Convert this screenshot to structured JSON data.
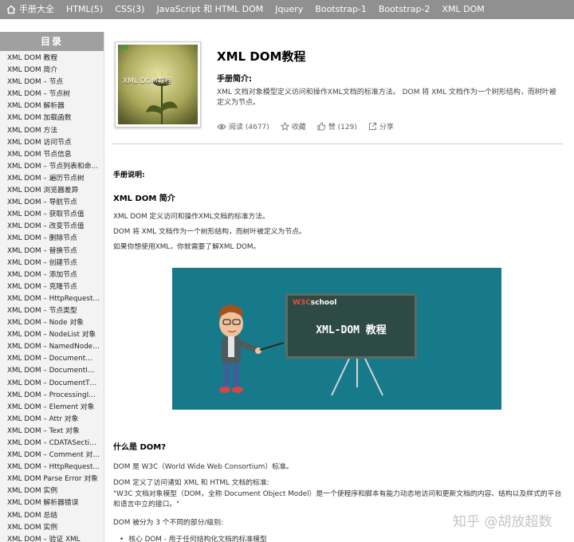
{
  "topnav": {
    "items": [
      "手册大全",
      "HTML(5)",
      "CSS(3)",
      "JavaScript 和 HTML DOM",
      "Jquery",
      "Bootstrap-1",
      "Bootstrap-2",
      "XML DOM"
    ]
  },
  "sidebar": {
    "title": "目录",
    "items": [
      "XML DOM 教程",
      "XML DOM 简介",
      "XML DOM – 节点",
      "XML DOM – 节点树",
      "XML DOM 解析器",
      "XML DOM 加载函数",
      "XML DOM 方法",
      "XML DOM 访问节点",
      "XML DOM 节点信息",
      "XML DOM – 节点列表和命…",
      "XML DOM – 遍历节点树",
      "XML DOM 浏览器差异",
      "XML DOM – 导航节点",
      "XML DOM – 获取节点值",
      "XML DOM – 改变节点值",
      "XML DOM – 删除节点",
      "XML DOM – 替换节点",
      "XML DOM – 创建节点",
      "XML DOM – 添加节点",
      "XML DOM – 克隆节点",
      "XML DOM – HttpRequest…",
      "XML DOM – 节点类型",
      "XML DOM – Node 对象",
      "XML DOM – NodeList 对象",
      "XML DOM – NamedNode…",
      "XML DOM – Document…",
      "XML DOM – DocumentI…",
      "XML DOM – DocumentT…",
      "XML DOM – ProcessingI…",
      "XML DOM – Element 对象",
      "XML DOM – Attr 对象",
      "XML DOM – Text 对象",
      "XML DOM – CDATASecti…",
      "XML DOM – Comment 对…",
      "XML DOM – HttpRequest…",
      "XML DOM Parse Error 对象",
      "XML DOM 实例",
      "XML DOM 解析器错误",
      "XML DOM 总结",
      "XML DOM 实例",
      "XML DOM – 验证 XML"
    ]
  },
  "book": {
    "cover_title": "XML DOM教程",
    "title": "XML DOM教程",
    "intro_label": "手册简介:",
    "intro_text": "XML 文档对象模型定义访问和操作XML文档的标准方法。 DOM 将 XML 文档作为一个树形结构，而树叶被定义为节点。",
    "actions": {
      "read": "阅读 (4677)",
      "favorite": "收藏",
      "like": "赞 (129)",
      "share": "分享"
    }
  },
  "content": {
    "manual_heading": "手册说明:",
    "dom_intro_heading": "XML DOM 简介",
    "intro_lines": [
      "XML DOM 定义访问和操作XML文档的标准方法。",
      "DOM 将 XML 文档作为一个树形结构，而树叶被定义为节点。",
      "如果你想使用XML，你就需要了解XML DOM。"
    ],
    "banner": {
      "logo_w3c": "W3C",
      "logo_school": "school",
      "board_text": "XML-DOM 教程"
    },
    "what_heading": "什么是 DOM?",
    "what_lines": [
      "DOM 是 W3C（World Wide Web Consortium）标准。",
      "DOM 定义了访问诸如 XML 和 HTML 文档的标准:"
    ],
    "quote": "\"W3C 文档对象模型（DOM，全称 Document Object Model）是一个使程序和脚本有能力动态地访问和更新文档的内容、结构以及样式的平台和语言中立的接口。\"",
    "parts_line": "DOM 被分为 3 个不同的部分/级别:",
    "bullet": "核心 DOM - 用于任何结构化文档的标准模型"
  },
  "watermark": "知乎 @胡放超数",
  "colors": {
    "topnav_bg": "#909090",
    "sidebar_title_bg": "#a0a0a0",
    "banner_bg": "#177a8a"
  }
}
